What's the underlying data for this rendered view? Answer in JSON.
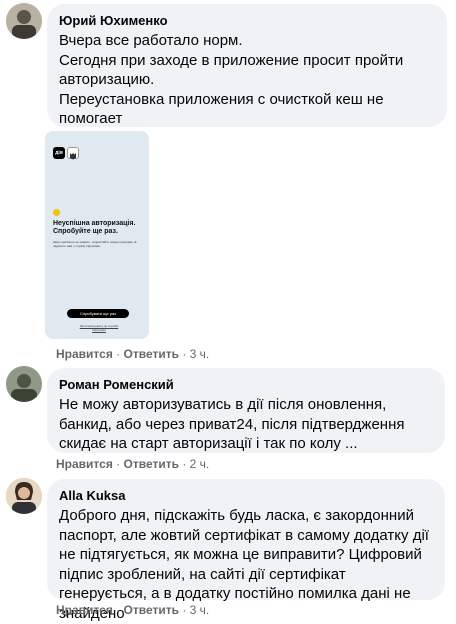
{
  "comments": [
    {
      "author": "Юрий Юхименко",
      "text": "Вчера все работало норм.\nСегодня при заходе в приложение просит пройти авторизацию.\nПереустановка приложения с очисткой кеш не помогает",
      "like": "Нравится",
      "reply": "Ответить",
      "time": "3 ч.",
      "avatar_color": "#8a8170"
    },
    {
      "author": "Роман Роменский",
      "text": "Не можу авторизуватись в дії після оновлення, банкид, або через приват24, після підтвердження скидає на старт авторизації і так по колу ...",
      "like": "Нравится",
      "reply": "Ответить",
      "time": "2 ч.",
      "avatar_color": "#6f7768"
    },
    {
      "author": "Alla Kuksa",
      "text": "Доброго дня, підскажіть будь ласка, є закордонний паспорт, але жовтий сертифікат в самому додатку дії не підтягується, як можна це виправити? Цифровий підпис зроблений, на сайті дії сертифікат генерується, а в додатку постійно помилка дані не знайдено",
      "like": "Нравится",
      "reply": "Ответить",
      "time": "3 ч.",
      "avatar_color": "#b89a7e"
    }
  ],
  "separator": "·",
  "attachment": {
    "logo": "дія",
    "error_title": "Неуспішна авторизація. Спробуйте ще раз.",
    "error_body": "Щось зроблено не знаємо - скористайте номер програми та надсилте нам у службу підтримки",
    "retry_label": "Спробувати ще раз",
    "link_label": "Зателефонувати до служби підтримки"
  }
}
